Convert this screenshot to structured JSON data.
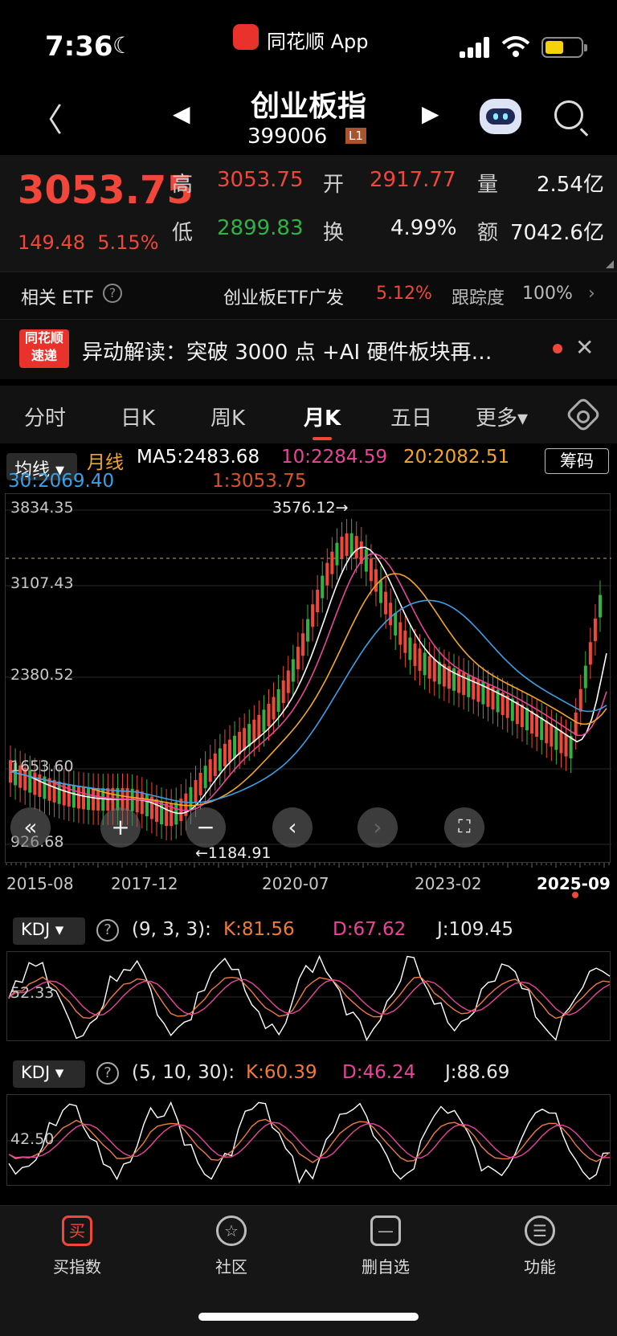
{
  "status": {
    "time": "7:36",
    "app_name": "同花顺 App"
  },
  "nav": {
    "title": "创业板指",
    "code": "399006",
    "level": "L1"
  },
  "quote": {
    "price": "3053.75",
    "change": "149.48",
    "change_pct": "5.15%",
    "high_label": "高",
    "high": "3053.75",
    "open_label": "开",
    "open": "2917.77",
    "vol_label": "量",
    "vol": "2.54亿",
    "low_label": "低",
    "low": "2899.83",
    "turnover_label": "换",
    "turnover": "4.99%",
    "amount_label": "额",
    "amount": "7042.6亿"
  },
  "etf": {
    "label": "相关 ETF",
    "name": "创业板ETF广发",
    "pct": "5.12%",
    "track_label": "跟踪度",
    "track": "100%"
  },
  "news": {
    "logo_top": "同花顺",
    "logo_bottom": "速递",
    "text": "异动解读：突破 3000 点 +AI 硬件板块再…"
  },
  "tabs": [
    "分时",
    "日K",
    "周K",
    "月K",
    "五日",
    "更多▾"
  ],
  "ma": {
    "selector": "均线 ▾",
    "period": "月线",
    "ma5": "MA5:2483.68",
    "ma10": "10:2284.59",
    "ma20": "20:2082.51",
    "ma30": "30:2069.40",
    "ma1": "1:3053.75",
    "chip_button": "筹码"
  },
  "main_chart": {
    "y_labels": [
      "3834.35",
      "3107.43",
      "2380.52",
      "1653.60",
      "926.68"
    ],
    "x_labels": [
      "2015-08",
      "2017-12",
      "2020-07",
      "2023-02",
      "2025-09"
    ],
    "max_annotation": "3576.12→",
    "min_annotation": "←1184.91"
  },
  "kdj1": {
    "selector": "KDJ ▾",
    "params": "(9, 3, 3):",
    "k": "K:81.56",
    "d": "D:67.62",
    "j": "J:109.45",
    "ref": "52.33"
  },
  "kdj2": {
    "selector": "KDJ ▾",
    "params": "(5, 10, 30):",
    "k": "K:60.39",
    "d": "D:46.24",
    "j": "J:88.69",
    "ref": "42.50"
  },
  "bottom": [
    {
      "icon": "买",
      "label": "买指数"
    },
    {
      "icon": "☆",
      "label": "社区"
    },
    {
      "icon": "—",
      "label": "删自选"
    },
    {
      "icon": "☰",
      "label": "功能"
    }
  ],
  "colors": {
    "up": "#f0473a",
    "down": "#2fb344",
    "ma5": "#ffffff",
    "ma10": "#e8459a",
    "ma20": "#f5a623",
    "ma30": "#3aa0e8",
    "ma1": "#d9532b",
    "k": "#f07a3a",
    "d": "#e8459a",
    "j": "#ffffff"
  }
}
